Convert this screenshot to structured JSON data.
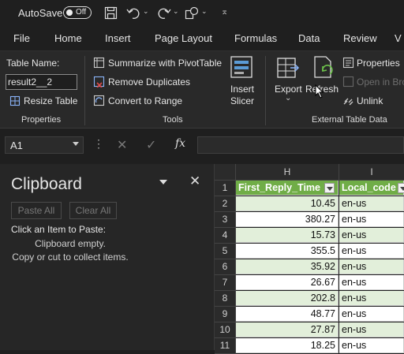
{
  "titlebar": {
    "autosave_label": "AutoSave",
    "autosave_state": "Off"
  },
  "menu": [
    "File",
    "Home",
    "Insert",
    "Page Layout",
    "Formulas",
    "Data",
    "Review",
    "V"
  ],
  "ribbon": {
    "properties": {
      "table_name_label": "Table Name:",
      "table_name_value": "result2__2",
      "resize_table": "Resize Table",
      "group_label": "Properties"
    },
    "tools": {
      "summarize": "Summarize with PivotTable",
      "remove_duplicates": "Remove Duplicates",
      "convert_to_range": "Convert to Range",
      "insert_slicer_line1": "Insert",
      "insert_slicer_line2": "Slicer",
      "group_label": "Tools"
    },
    "external": {
      "export": "Export",
      "refresh": "Refresh",
      "properties": "Properties",
      "open_in_browser": "Open in Bro",
      "unlink": "Unlink",
      "group_label": "External Table Data"
    }
  },
  "formula_bar": {
    "name_box": "A1",
    "fx": "fx",
    "value": ""
  },
  "clipboard": {
    "title": "Clipboard",
    "paste_all": "Paste All",
    "clear_all": "Clear All",
    "instruction": "Click an Item to Paste:",
    "empty_line1": "Clipboard empty.",
    "empty_line2": "Copy or cut to collect items."
  },
  "grid": {
    "col_headers": [
      "H",
      "I"
    ],
    "header_row": {
      "row": "1",
      "h": "First_Reply_Time",
      "i": "Local_code"
    },
    "rows": [
      {
        "row": "2",
        "h": "10.45",
        "i": "en-us"
      },
      {
        "row": "3",
        "h": "380.27",
        "i": "en-us"
      },
      {
        "row": "4",
        "h": "15.73",
        "i": "en-us"
      },
      {
        "row": "5",
        "h": "355.5",
        "i": "en-us"
      },
      {
        "row": "6",
        "h": "35.92",
        "i": "en-us"
      },
      {
        "row": "7",
        "h": "26.67",
        "i": "en-us"
      },
      {
        "row": "8",
        "h": "202.8",
        "i": "en-us"
      },
      {
        "row": "9",
        "h": "48.77",
        "i": "en-us"
      },
      {
        "row": "10",
        "h": "27.87",
        "i": "en-us"
      },
      {
        "row": "11",
        "h": "18.25",
        "i": "en-us"
      }
    ]
  }
}
